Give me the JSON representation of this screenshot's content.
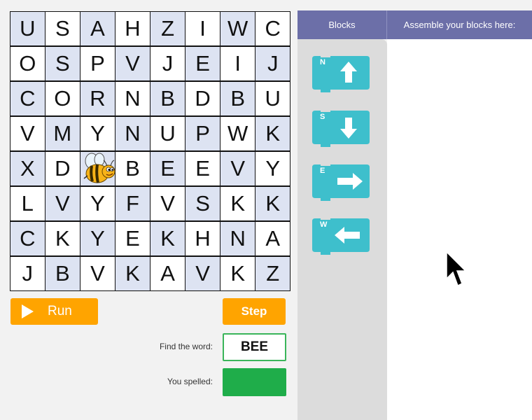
{
  "grid": {
    "rows": [
      [
        "U",
        "S",
        "A",
        "H",
        "Z",
        "I",
        "W",
        "C"
      ],
      [
        "O",
        "S",
        "P",
        "V",
        "J",
        "E",
        "I",
        "J"
      ],
      [
        "C",
        "O",
        "R",
        "N",
        "B",
        "D",
        "B",
        "U"
      ],
      [
        "V",
        "M",
        "Y",
        "N",
        "U",
        "P",
        "W",
        "K"
      ],
      [
        "X",
        "D",
        "",
        "B",
        "E",
        "E",
        "V",
        "Y"
      ],
      [
        "L",
        "V",
        "Y",
        "F",
        "V",
        "S",
        "K",
        "K"
      ],
      [
        "C",
        "K",
        "Y",
        "E",
        "K",
        "H",
        "N",
        "A"
      ],
      [
        "J",
        "B",
        "V",
        "K",
        "A",
        "V",
        "K",
        "Z"
      ]
    ],
    "bee_position": {
      "row": 4,
      "col": 2
    }
  },
  "controls": {
    "run_label": "Run",
    "step_label": "Step",
    "find_word_label": "Find the word:",
    "find_word_value": "BEE",
    "you_spelled_label": "You spelled:",
    "you_spelled_value": ""
  },
  "workspace": {
    "blocks_tab": "Blocks",
    "assemble_tab": "Assemble your blocks here:"
  },
  "blocks": [
    {
      "letter": "N",
      "direction": "up"
    },
    {
      "letter": "S",
      "direction": "down"
    },
    {
      "letter": "E",
      "direction": "right"
    },
    {
      "letter": "W",
      "direction": "left"
    }
  ],
  "colors": {
    "accent_orange": "#ffa400",
    "block_teal": "#3ebfcc",
    "header_purple": "#6c6fa8",
    "success_green": "#1fad4a",
    "shaded_cell": "#dde3f2"
  }
}
